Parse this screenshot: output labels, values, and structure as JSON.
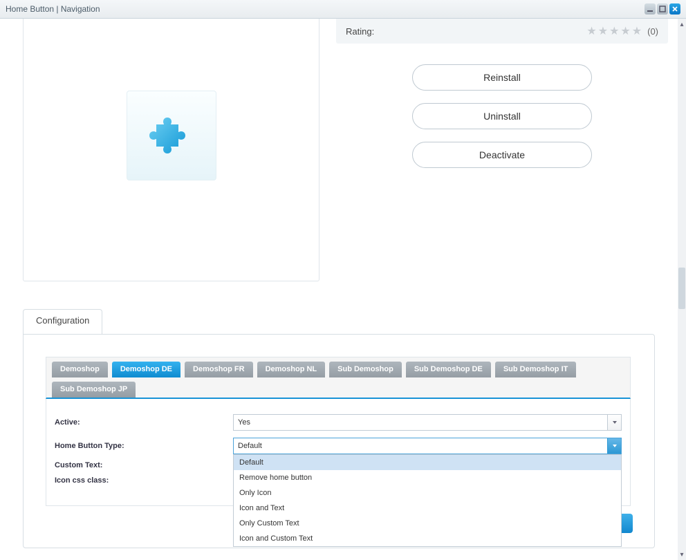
{
  "window": {
    "title": "Home Button | Navigation"
  },
  "rating": {
    "label": "Rating:",
    "count_text": "(0)"
  },
  "actions": {
    "reinstall": "Reinstall",
    "uninstall": "Uninstall",
    "deactivate": "Deactivate"
  },
  "configuration": {
    "tab_label": "Configuration",
    "shops": [
      {
        "label": "Demoshop",
        "active": false
      },
      {
        "label": "Demoshop DE",
        "active": true
      },
      {
        "label": "Demoshop FR",
        "active": false
      },
      {
        "label": "Demoshop NL",
        "active": false
      },
      {
        "label": "Sub Demoshop",
        "active": false
      },
      {
        "label": "Sub Demoshop DE",
        "active": false
      },
      {
        "label": "Sub Demoshop IT",
        "active": false
      },
      {
        "label": "Sub Demoshop JP",
        "active": false
      }
    ],
    "fields": {
      "active": {
        "label": "Active:",
        "value": "Yes"
      },
      "home_button_type": {
        "label": "Home Button Type:",
        "value": "Default"
      },
      "custom_text": {
        "label": "Custom Text:"
      },
      "icon_css_class": {
        "label": "Icon css class:"
      }
    },
    "home_button_type_options": [
      "Default",
      "Remove home button",
      "Only Icon",
      "Icon and Text",
      "Only Custom Text",
      "Icon and Custom Text"
    ]
  }
}
